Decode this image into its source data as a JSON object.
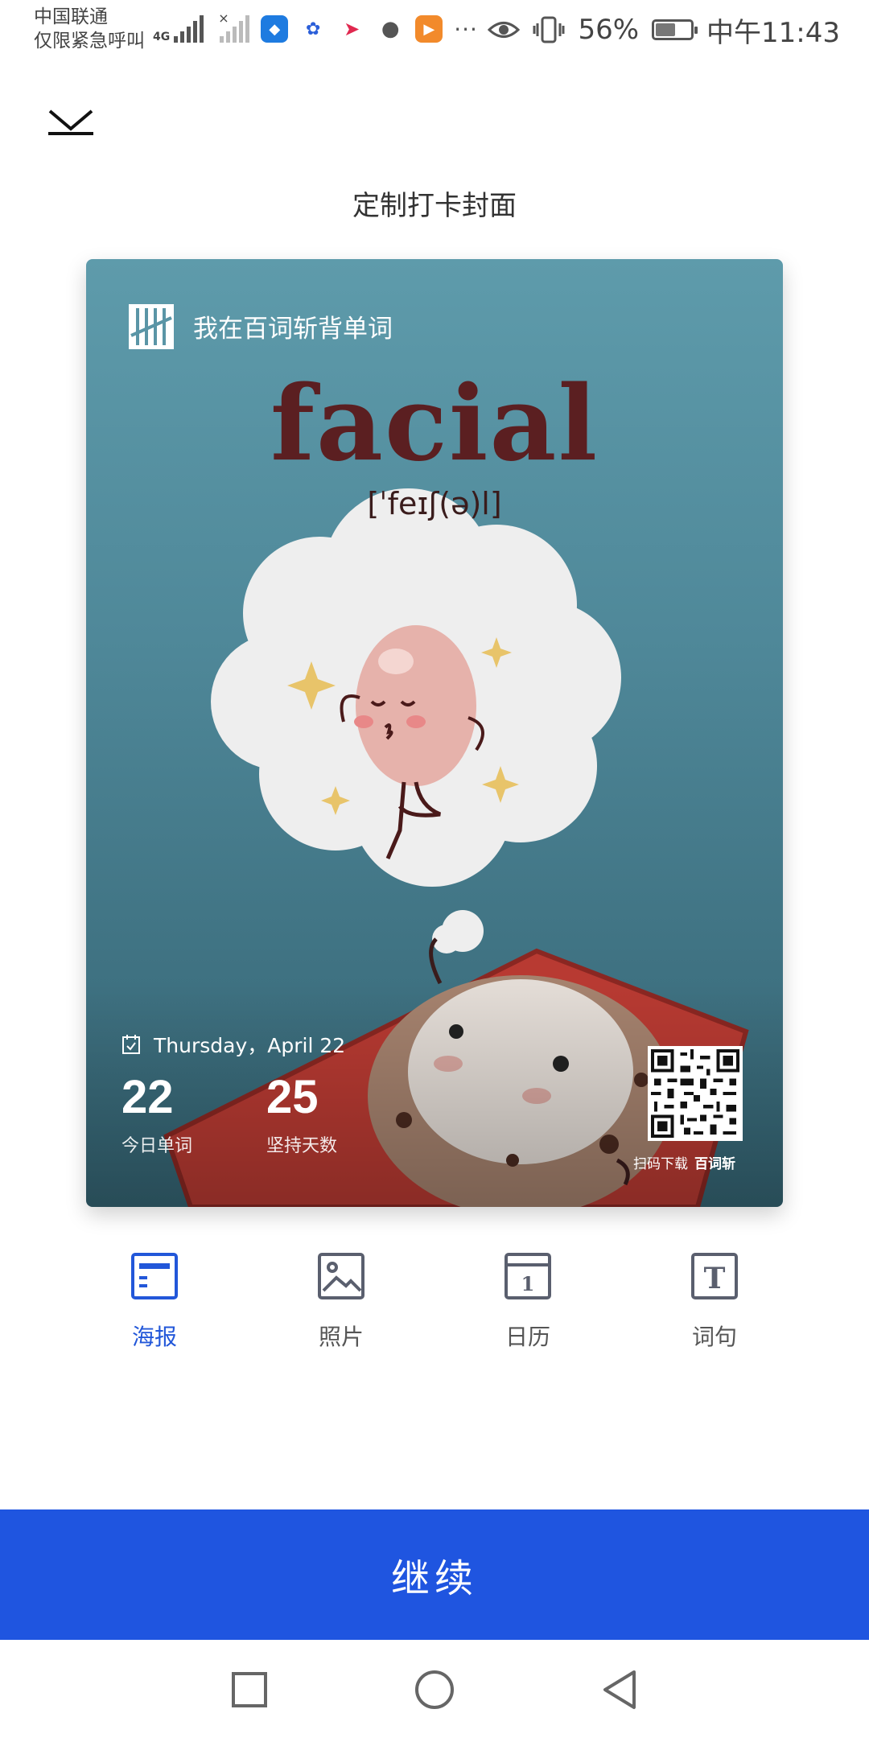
{
  "status_bar": {
    "carrier_line1": "中国联通",
    "carrier_line2": "仅限紧急呼叫",
    "network_type": "4G",
    "more": "···",
    "battery": "56%",
    "battery_level": 0.56,
    "time": "中午11:43"
  },
  "header": {
    "close_icon": "chevron-down-icon",
    "title": "定制打卡封面"
  },
  "poster": {
    "app_text": "我在百词斩背单词",
    "word": "facial",
    "phonetic": "[ˈfeɪʃ(ə)l]",
    "date": "Thursday，April 22",
    "stats": [
      {
        "value": "22",
        "label": "今日单词"
      },
      {
        "value": "25",
        "label": "坚持天数"
      }
    ],
    "qr_caption": "扫码下载",
    "qr_brand": "百词斩"
  },
  "tabs": [
    {
      "label": "海报",
      "icon": "poster-icon",
      "active": true
    },
    {
      "label": "照片",
      "icon": "image-icon",
      "active": false
    },
    {
      "label": "日历",
      "icon": "calendar-icon",
      "active": false
    },
    {
      "label": "词句",
      "icon": "text-icon",
      "active": false
    }
  ],
  "continue_label": "继续",
  "colors": {
    "accent": "#1f55e0",
    "active_tab": "#2257d9",
    "poster_bg": "#4f8899",
    "word_color": "#5b1f21"
  }
}
